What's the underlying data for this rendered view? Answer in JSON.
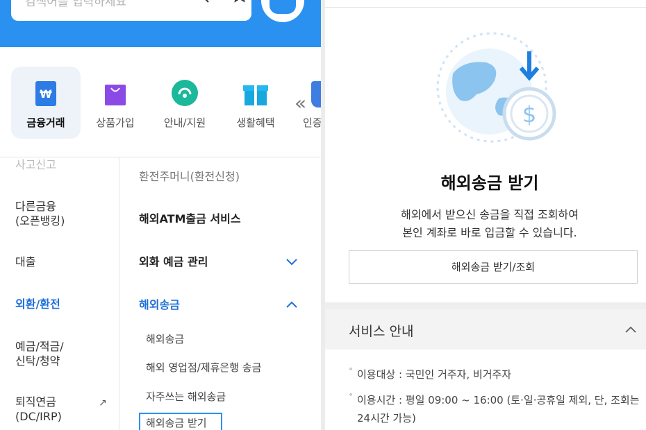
{
  "search": {
    "placeholder": "검색어를 입력하세요"
  },
  "categories": [
    {
      "label": "금융거래",
      "icon": "wallet-icon"
    },
    {
      "label": "상품가입",
      "icon": "shopping-bag-icon"
    },
    {
      "label": "안내/지원",
      "icon": "headset-icon"
    },
    {
      "label": "생활혜택",
      "icon": "gift-icon"
    },
    {
      "label": "인증"
    }
  ],
  "left_menu": {
    "items": [
      "사고신고",
      "다른금융\n(오픈뱅킹)",
      "대출",
      "외환/환전",
      "예금/적금/\n신탁/청약",
      "퇴직연금\n(DC/IRP)"
    ],
    "active": "외환/환전"
  },
  "right_menu": {
    "items": [
      "환전주머니(환전신청)",
      "해외ATM출금 서비스",
      "외화 예금 관리",
      "해외송금"
    ],
    "sub_items": [
      "해외송금",
      "해외 영업점/제휴은행 송금",
      "자주쓰는 해외송금",
      "해외송금 받기"
    ],
    "selected": "해외송금 받기"
  },
  "detail": {
    "title": "해외송금 받기",
    "desc_line1": "해외에서 받으신 송금을 직접 조회하여",
    "desc_line2": "본인 계좌로 바로 입금할 수 있습니다.",
    "button_label": "해외송금 받기/조회",
    "service_header": "서비스 안내",
    "bullets": [
      "이용대상 : 국민인 거주자, 비거주자",
      "이용시간 : 평일 09:00 ~ 16:00 (토·일·공휴일 제외, 단, 조회는 24시간 가능)"
    ]
  },
  "colors": {
    "brand": "#2b91f0",
    "active": "#1e6fd9"
  }
}
